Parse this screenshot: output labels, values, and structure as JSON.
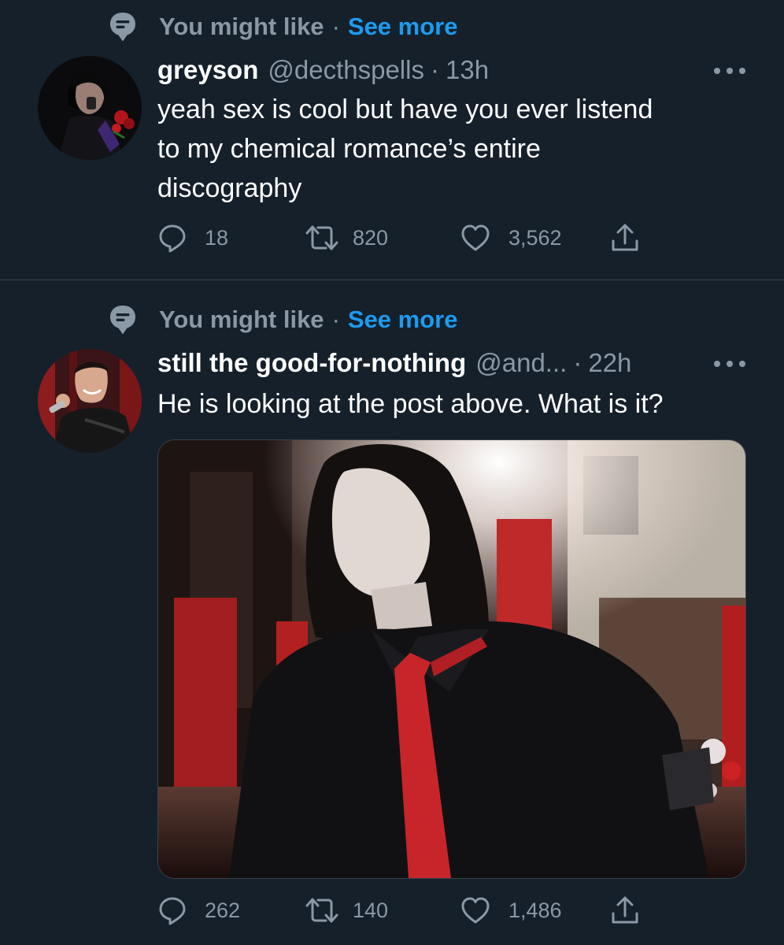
{
  "tweets": [
    {
      "context_label": "You might like",
      "context_separator": "·",
      "see_more": "See more",
      "display_name": "greyson",
      "handle": "@decthspells",
      "separator": "·",
      "time": "13h",
      "text_lines": [
        "yeah sex is cool but have you ever listend",
        "to my chemical romance’s entire",
        "discography"
      ],
      "replies": "18",
      "retweets": "820",
      "likes": "3,562"
    },
    {
      "context_label": "You might like",
      "context_separator": "·",
      "see_more": "See more",
      "display_name": "still the good-for-nothing",
      "handle": "@and...",
      "separator": "·",
      "time": "22h",
      "text_lines": [
        "He is looking at the post above. What is it?"
      ],
      "replies": "262",
      "retweets": "140",
      "likes": "1,486"
    }
  ],
  "icons": {
    "context": "topic-speech-bubble-icon",
    "more": "more-dots-icon",
    "reply": "reply-icon",
    "retweet": "retweet-icon",
    "like": "heart-icon",
    "share": "share-icon"
  },
  "colors": {
    "background": "#15202b",
    "text_primary": "#ffffff",
    "text_secondary": "#8b98a5",
    "link": "#1d9bf0",
    "divider": "#38444d"
  }
}
